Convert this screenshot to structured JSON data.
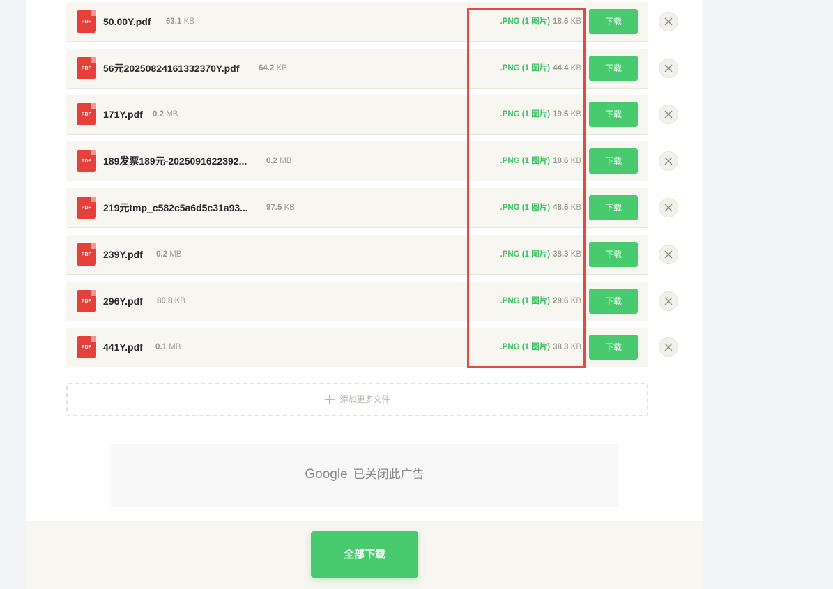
{
  "files": [
    {
      "name": "50.00Y.pdf",
      "size_num": "63.1",
      "size_unit": "KB",
      "out_format": ".PNG (1 图片)",
      "out_size_num": "18.6",
      "out_size_unit": "KB",
      "download_label": "下载"
    },
    {
      "name": "56元20250824161332370Y.pdf",
      "size_num": "64.2",
      "size_unit": "KB",
      "out_format": ".PNG (1 图片)",
      "out_size_num": "44.4",
      "out_size_unit": "KB",
      "download_label": "下载"
    },
    {
      "name": "171Y.pdf",
      "size_num": "0.2",
      "size_unit": "MB",
      "out_format": ".PNG (1 图片)",
      "out_size_num": "19.5",
      "out_size_unit": "KB",
      "download_label": "下载"
    },
    {
      "name": "189发票189元-2025091622392...",
      "size_num": "0.2",
      "size_unit": "MB",
      "out_format": ".PNG (1 图片)",
      "out_size_num": "18.6",
      "out_size_unit": "KB",
      "download_label": "下载"
    },
    {
      "name": "219元tmp_c582c5a6d5c31a93...",
      "size_num": "97.5",
      "size_unit": "KB",
      "out_format": ".PNG (1 图片)",
      "out_size_num": "48.6",
      "out_size_unit": "KB",
      "download_label": "下载"
    },
    {
      "name": "239Y.pdf",
      "size_num": "0.2",
      "size_unit": "MB",
      "out_format": ".PNG (1 图片)",
      "out_size_num": "38.3",
      "out_size_unit": "KB",
      "download_label": "下载"
    },
    {
      "name": "296Y.pdf",
      "size_num": "80.8",
      "size_unit": "KB",
      "out_format": ".PNG (1 图片)",
      "out_size_num": "29.6",
      "out_size_unit": "KB",
      "download_label": "下载"
    },
    {
      "name": "441Y.pdf",
      "size_num": "0.1",
      "size_unit": "MB",
      "out_format": ".PNG (1 图片)",
      "out_size_num": "38.3",
      "out_size_unit": "KB",
      "download_label": "下载"
    }
  ],
  "file_icon_label": "PDF",
  "add_more_label": "添加更多文件",
  "ad": {
    "brand": "Google",
    "text": "已关闭此广告"
  },
  "download_all_label": "全部下载",
  "colors": {
    "accent_green": "#48cb6f",
    "pdf_red": "#e5413a",
    "highlight_red": "#e04b48"
  }
}
